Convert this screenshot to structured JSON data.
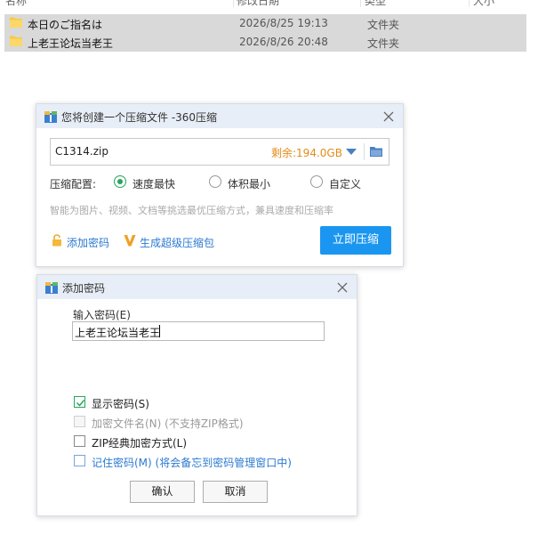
{
  "file_list": {
    "header": {
      "name": "名称",
      "date": "修改日期",
      "type": "类型",
      "size": "大小"
    },
    "rows": [
      {
        "name": "本日のご指名は",
        "date": "2026/8/25 19:13",
        "type": "文件夹"
      },
      {
        "name": "上老王论坛当老王",
        "date": "2026/8/26 20:48",
        "type": "文件夹"
      }
    ],
    "folder_color": "#f7c948",
    "selected_bg": "#d9d9d9"
  },
  "compress_dialog": {
    "title": "您将创建一个压缩文件 -360压缩",
    "filename": "C1314.zip",
    "free_space": "剩余:194.0GB",
    "config_label": "压缩配置:",
    "options": [
      {
        "label": "速度最快",
        "selected": true
      },
      {
        "label": "体积最小",
        "selected": false
      },
      {
        "label": "自定义",
        "selected": false
      }
    ],
    "hint": "智能为图片、视频、文档等挑选最优压缩方式，兼具速度和压缩率",
    "add_password": "添加密码",
    "super_compress": "生成超级压缩包",
    "compress_button": "立即压缩",
    "accent": "#1a96f0"
  },
  "password_dialog": {
    "title": "添加密码",
    "input_label": "输入密码(E)",
    "password_value": "上老王论坛当老王",
    "checkboxes": [
      {
        "label": "显示密码(S)",
        "checked": true,
        "disabled": false
      },
      {
        "label": "加密文件名(N) (不支持ZIP格式)",
        "checked": false,
        "disabled": true
      },
      {
        "label": "ZIP经典加密方式(L)",
        "checked": false,
        "disabled": false
      },
      {
        "label": "记住密码(M) (将会备忘到密码管理窗口中)",
        "checked": false,
        "disabled": false
      }
    ],
    "ok_button": "确认",
    "cancel_button": "取消"
  }
}
